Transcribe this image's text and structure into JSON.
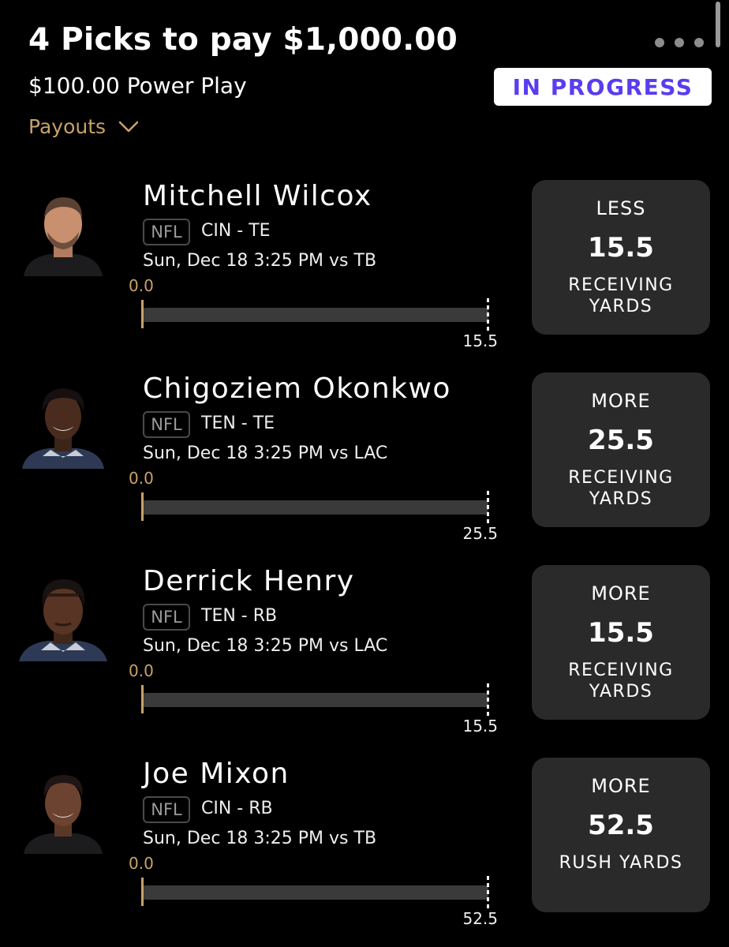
{
  "header": {
    "title": "4 Picks to pay $1,000.00",
    "subtitle": "$100.00 Power Play",
    "status": "IN PROGRESS",
    "payouts_label": "Payouts"
  },
  "colors": {
    "background": "#000000",
    "accent_gold": "#c9a16a",
    "status_text": "#5a3cf0",
    "card_bg": "#2a2a2a",
    "track_bg": "#3a3a3a"
  },
  "picks": [
    {
      "name": "Mitchell Wilcox",
      "league": "NFL",
      "team_pos": "CIN - TE",
      "game": "Sun, Dec 18 3:25 PM  vs TB",
      "current": "0.0",
      "progress_fraction": 0,
      "target": "15.5",
      "direction": "LESS",
      "line": "15.5",
      "stat": "RECEIVING YARDS"
    },
    {
      "name": "Chigoziem Okonkwo",
      "league": "NFL",
      "team_pos": "TEN - TE",
      "game": "Sun, Dec 18 3:25 PM  vs LAC",
      "current": "0.0",
      "progress_fraction": 0,
      "target": "25.5",
      "direction": "MORE",
      "line": "25.5",
      "stat": "RECEIVING YARDS"
    },
    {
      "name": "Derrick Henry",
      "league": "NFL",
      "team_pos": "TEN - RB",
      "game": "Sun, Dec 18 3:25 PM  vs LAC",
      "current": "0.0",
      "progress_fraction": 0,
      "target": "15.5",
      "direction": "MORE",
      "line": "15.5",
      "stat": "RECEIVING YARDS"
    },
    {
      "name": "Joe Mixon",
      "league": "NFL",
      "team_pos": "CIN - RB",
      "game": "Sun, Dec 18 3:25 PM  vs TB",
      "current": "0.0",
      "progress_fraction": 0,
      "target": "52.5",
      "direction": "MORE",
      "line": "52.5",
      "stat": "RUSH YARDS"
    }
  ]
}
